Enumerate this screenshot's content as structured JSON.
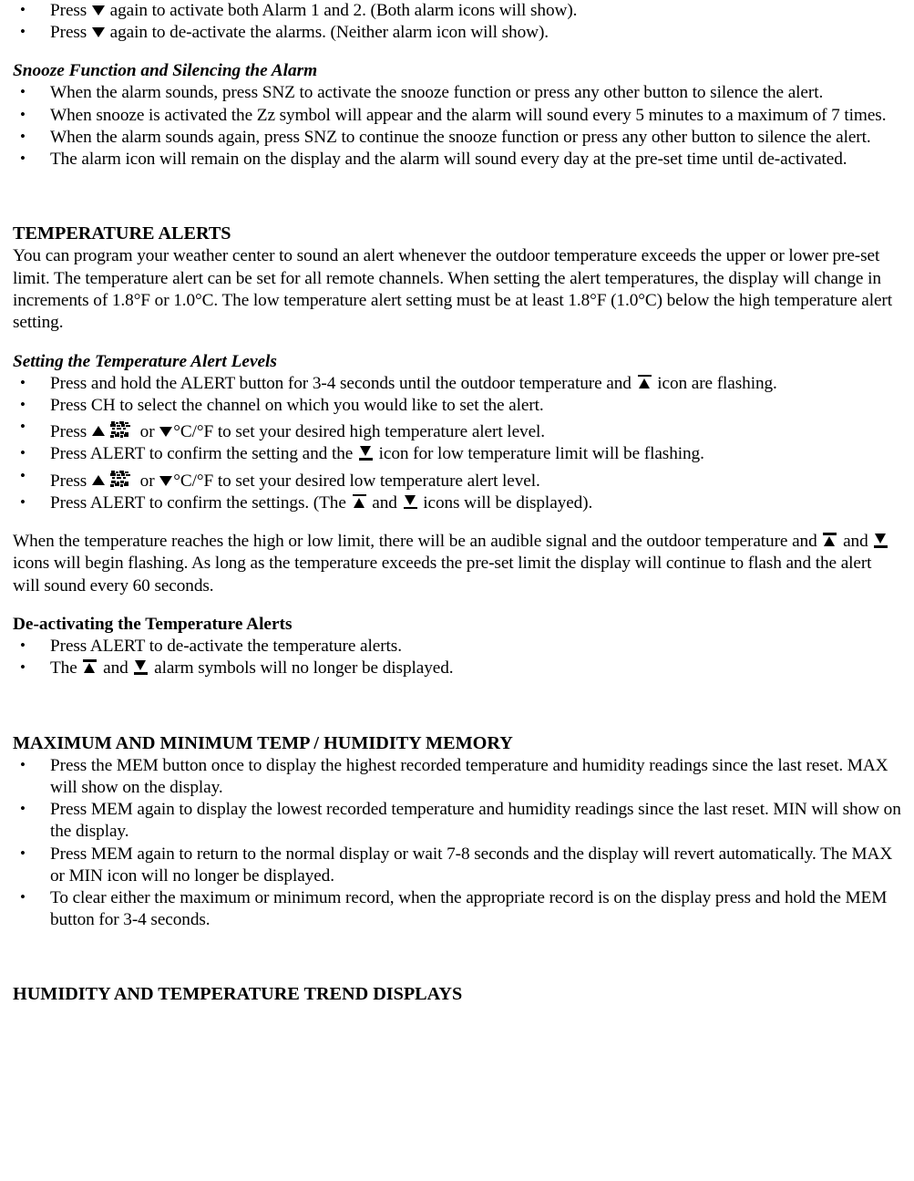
{
  "document": {
    "blocks": [
      {
        "id": "b1",
        "type": "bullet",
        "parts": [
          {
            "t": "text",
            "v": "Press "
          },
          {
            "t": "icon",
            "v": "triangle-down-icon"
          },
          {
            "t": "text",
            "v": " again to activate both Alarm 1 and 2.  (Both alarm icons will show)."
          }
        ]
      },
      {
        "id": "b2",
        "type": "bullet",
        "parts": [
          {
            "t": "text",
            "v": "Press "
          },
          {
            "t": "icon",
            "v": "triangle-down-icon"
          },
          {
            "t": "text",
            "v": " again to de-activate the alarms.  (Neither alarm icon will show)."
          }
        ]
      },
      {
        "id": "g1",
        "type": "gap",
        "size": "md"
      },
      {
        "id": "h1",
        "type": "subhead",
        "italic": true,
        "text": "Snooze Function and Silencing the Alarm"
      },
      {
        "id": "b3",
        "type": "bullet",
        "parts": [
          {
            "t": "text",
            "v": "When the alarm sounds, press SNZ to activate the snooze function or press any other button to silence the alert."
          }
        ]
      },
      {
        "id": "b4",
        "type": "bullet",
        "parts": [
          {
            "t": "text",
            "v": "When snooze is activated the Zz symbol will appear and the alarm will sound every 5 minutes to a maximum of 7 times."
          }
        ]
      },
      {
        "id": "b5",
        "type": "bullet",
        "parts": [
          {
            "t": "text",
            "v": "When the alarm sounds again, press SNZ to continue the snooze function or press any other button to silence the alert."
          }
        ]
      },
      {
        "id": "b6",
        "type": "bullet",
        "parts": [
          {
            "t": "text",
            "v": "The alarm icon will remain on the display and the alarm will sound every day at the pre-set time until de-activated."
          }
        ]
      },
      {
        "id": "g2",
        "type": "gap",
        "size": "xxl"
      },
      {
        "id": "h2",
        "type": "sectionhead",
        "text": "TEMPERATURE ALERTS"
      },
      {
        "id": "p1",
        "type": "para",
        "parts": [
          {
            "t": "text",
            "v": "You can program your weather center to sound an alert whenever the outdoor temperature exceeds the upper or lower pre-set limit.  The temperature alert can be set for all remote channels.  When setting the alert temperatures, the display will change in increments of 1.8°F or 1.0°C.  The low temperature alert setting must be at least 1.8°F (1.0°C) below the high temperature alert setting."
          }
        ]
      },
      {
        "id": "g3",
        "type": "gap",
        "size": "md"
      },
      {
        "id": "h3",
        "type": "subhead",
        "italic": true,
        "text": "Setting the Temperature Alert Levels"
      },
      {
        "id": "b7",
        "type": "bullet",
        "parts": [
          {
            "t": "text",
            "v": "Press and hold the ALERT button for 3-4 seconds until the outdoor temperature and "
          },
          {
            "t": "icon",
            "v": "high-temp-alert-icon"
          },
          {
            "t": "text",
            "v": " icon are flashing."
          }
        ]
      },
      {
        "id": "b8",
        "type": "bullet",
        "parts": [
          {
            "t": "text",
            "v": "Press CH to select the channel on which you would like to set the alert."
          }
        ]
      },
      {
        "id": "b9",
        "type": "bullet",
        "parts": [
          {
            "t": "text",
            "v": "Press "
          },
          {
            "t": "icon",
            "v": "triangle-up-icon"
          },
          {
            "t": "icon",
            "v": "button-label-bitmap-icon"
          },
          {
            "t": "text",
            "v": " or "
          },
          {
            "t": "icon",
            "v": "triangle-down-icon"
          },
          {
            "t": "text",
            "v": "°C/°F to set your desired high temperature alert level."
          }
        ]
      },
      {
        "id": "b10",
        "type": "bullet",
        "parts": [
          {
            "t": "text",
            "v": "Press ALERT to confirm the setting and the "
          },
          {
            "t": "icon",
            "v": "low-temp-alert-icon"
          },
          {
            "t": "text",
            "v": " icon for low temperature limit will be flashing."
          }
        ]
      },
      {
        "id": "b11",
        "type": "bullet",
        "parts": [
          {
            "t": "text",
            "v": "Press "
          },
          {
            "t": "icon",
            "v": "triangle-up-icon"
          },
          {
            "t": "icon",
            "v": "button-label-bitmap-icon"
          },
          {
            "t": "text",
            "v": " or "
          },
          {
            "t": "icon",
            "v": "triangle-down-icon"
          },
          {
            "t": "text",
            "v": "°C/°F to set your desired low temperature alert level."
          }
        ]
      },
      {
        "id": "b12",
        "type": "bullet",
        "parts": [
          {
            "t": "text",
            "v": "Press ALERT to confirm the settings.  (The "
          },
          {
            "t": "icon",
            "v": "high-temp-alert-icon"
          },
          {
            "t": "text",
            "v": " and "
          },
          {
            "t": "icon",
            "v": "low-temp-alert-icon"
          },
          {
            "t": "text",
            "v": " icons will be displayed)."
          }
        ]
      },
      {
        "id": "g4",
        "type": "gap",
        "size": "md"
      },
      {
        "id": "p2",
        "type": "para",
        "parts": [
          {
            "t": "text",
            "v": "When the temperature reaches the high or low limit, there will be an audible signal and the outdoor temperature and  "
          },
          {
            "t": "icon",
            "v": "high-temp-alert-icon"
          },
          {
            "t": "text",
            "v": " and "
          },
          {
            "t": "icon",
            "v": "low-temp-alert-icon"
          },
          {
            "t": "text",
            "v": " icons will begin flashing.  As long as the temperature exceeds the pre-set limit the display will continue to flash and the alert will sound every 60 seconds."
          }
        ]
      },
      {
        "id": "g5",
        "type": "gap",
        "size": "md"
      },
      {
        "id": "h4",
        "type": "subhead",
        "italic": false,
        "text": "De-activating the Temperature Alerts"
      },
      {
        "id": "b13",
        "type": "bullet",
        "parts": [
          {
            "t": "text",
            "v": "Press ALERT to de-activate the temperature alerts."
          }
        ]
      },
      {
        "id": "b14",
        "type": "bullet",
        "parts": [
          {
            "t": "text",
            "v": "The "
          },
          {
            "t": "icon",
            "v": "high-temp-alert-icon"
          },
          {
            "t": "text",
            "v": " and "
          },
          {
            "t": "icon",
            "v": "low-temp-alert-icon"
          },
          {
            "t": "text",
            "v": " alarm symbols will no longer be displayed."
          }
        ]
      },
      {
        "id": "g6",
        "type": "gap",
        "size": "xxl"
      },
      {
        "id": "h5",
        "type": "sectionhead",
        "text": "MAXIMUM AND MINIMUM TEMP / HUMIDITY MEMORY"
      },
      {
        "id": "b15",
        "type": "bullet",
        "parts": [
          {
            "t": "text",
            "v": "Press the MEM button once to display the highest recorded temperature and humidity readings since the last reset.  MAX will show on the display."
          }
        ]
      },
      {
        "id": "b16",
        "type": "bullet",
        "parts": [
          {
            "t": "text",
            "v": "Press MEM again to display the lowest recorded temperature and humidity readings since the last reset.  MIN will show on the display."
          }
        ]
      },
      {
        "id": "b17",
        "type": "bullet",
        "parts": [
          {
            "t": "text",
            "v": "Press MEM again to return to the normal display or wait 7-8 seconds and the display will revert automatically.  The MAX or MIN icon will no longer be displayed."
          }
        ]
      },
      {
        "id": "b18",
        "type": "bullet",
        "parts": [
          {
            "t": "text",
            "v": "To clear either the maximum or minimum record, when the appropriate record is on the display press and hold the MEM button for 3-4 seconds."
          }
        ]
      },
      {
        "id": "g7",
        "type": "gap",
        "size": "xxl"
      },
      {
        "id": "h6",
        "type": "sectionhead",
        "text": "HUMIDITY AND TEMPERATURE TREND DISPLAYS"
      }
    ]
  },
  "colors": {
    "text": "#000000",
    "background": "#ffffff"
  }
}
